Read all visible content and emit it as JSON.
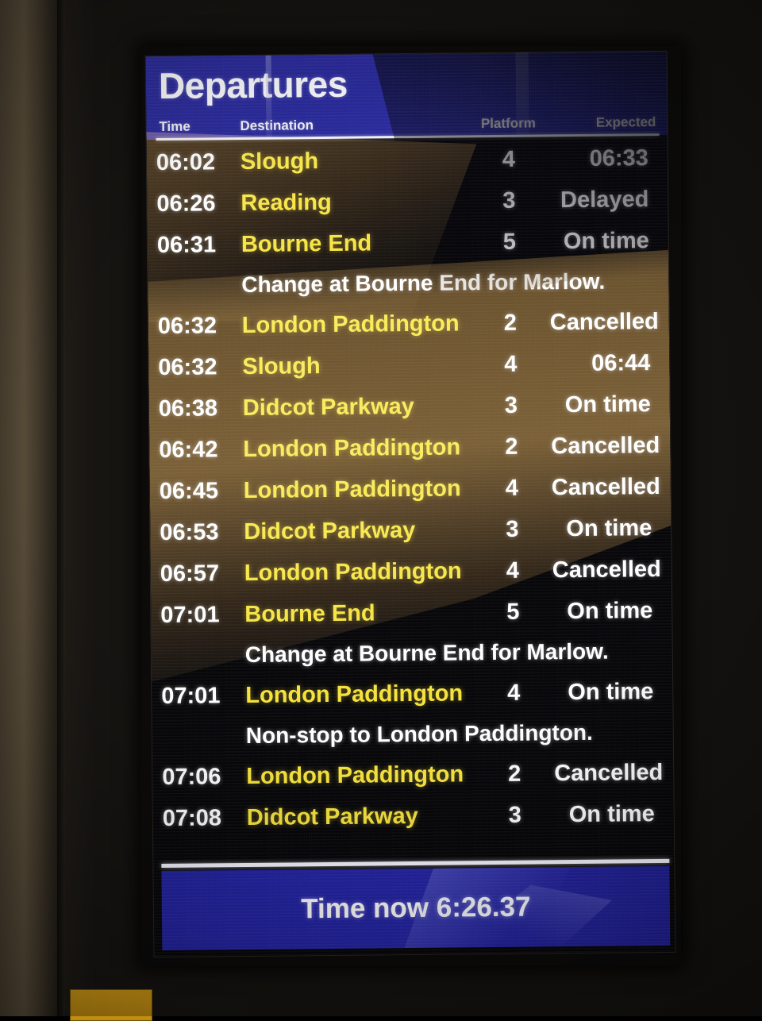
{
  "board": {
    "title": "Departures",
    "columns": {
      "time": "Time",
      "destination": "Destination",
      "platform": "Platform",
      "expected": "Expected"
    },
    "rows": [
      {
        "kind": "service",
        "time": "06:02",
        "destination": "Slough",
        "platform": "4",
        "expected": "06:33"
      },
      {
        "kind": "service",
        "time": "06:26",
        "destination": "Reading",
        "platform": "3",
        "expected": "Delayed"
      },
      {
        "kind": "service",
        "time": "06:31",
        "destination": "Bourne End",
        "platform": "5",
        "expected": "On time"
      },
      {
        "kind": "note",
        "note": "Change at Bourne End for Marlow."
      },
      {
        "kind": "service",
        "time": "06:32",
        "destination": "London Paddington",
        "platform": "2",
        "expected": "Cancelled"
      },
      {
        "kind": "service",
        "time": "06:32",
        "destination": "Slough",
        "platform": "4",
        "expected": "06:44"
      },
      {
        "kind": "service",
        "time": "06:38",
        "destination": "Didcot Parkway",
        "platform": "3",
        "expected": "On time"
      },
      {
        "kind": "service",
        "time": "06:42",
        "destination": "London Paddington",
        "platform": "2",
        "expected": "Cancelled"
      },
      {
        "kind": "service",
        "time": "06:45",
        "destination": "London Paddington",
        "platform": "4",
        "expected": "Cancelled"
      },
      {
        "kind": "service",
        "time": "06:53",
        "destination": "Didcot Parkway",
        "platform": "3",
        "expected": "On time"
      },
      {
        "kind": "service",
        "time": "06:57",
        "destination": "London Paddington",
        "platform": "4",
        "expected": "Cancelled"
      },
      {
        "kind": "service",
        "time": "07:01",
        "destination": "Bourne End",
        "platform": "5",
        "expected": "On time"
      },
      {
        "kind": "note",
        "note": "Change at Bourne End for Marlow."
      },
      {
        "kind": "service",
        "time": "07:01",
        "destination": "London Paddington",
        "platform": "4",
        "expected": "On time"
      },
      {
        "kind": "note",
        "note": "Non-stop to London Paddington."
      },
      {
        "kind": "service",
        "time": "07:06",
        "destination": "London Paddington",
        "platform": "2",
        "expected": "Cancelled"
      },
      {
        "kind": "service",
        "time": "07:08",
        "destination": "Didcot Parkway",
        "platform": "3",
        "expected": "On time"
      }
    ],
    "footer": {
      "clock_text": "Time now 6:26.37"
    }
  },
  "colors": {
    "header_blue": "#2a2a9e",
    "footer_blue": "#2323a3",
    "destination_yellow": "#f6e23c",
    "text_white": "#ffffff",
    "screen_black": "#07070a",
    "sticker_amber": "#d29a16"
  }
}
